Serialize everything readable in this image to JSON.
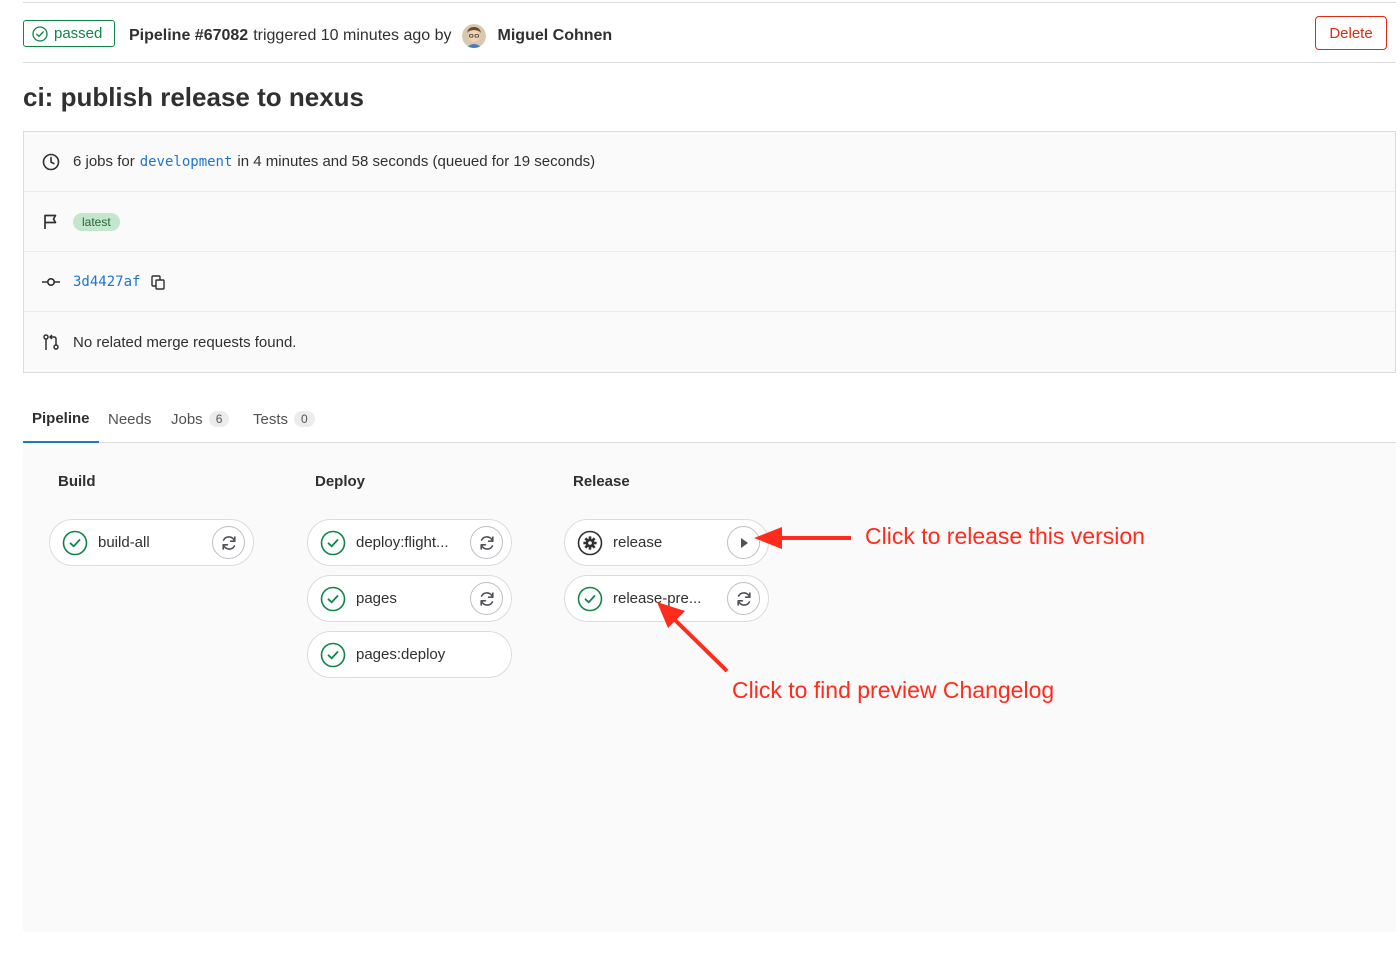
{
  "header": {
    "status": "passed",
    "pipeline_id": "Pipeline #67082",
    "triggered_text": "triggered 10 minutes ago by",
    "author": "Miguel Cohnen",
    "delete_label": "Delete"
  },
  "title": "ci: publish release to nexus",
  "info": {
    "jobs_prefix": "6 jobs for",
    "branch": "development",
    "jobs_suffix": "in 4 minutes and 58 seconds (queued for 19 seconds)",
    "tag": "latest",
    "commit": "3d4427af",
    "merge_requests": "No related merge requests found."
  },
  "tabs": [
    {
      "label": "Pipeline",
      "count": null,
      "active": true
    },
    {
      "label": "Needs",
      "count": null,
      "active": false
    },
    {
      "label": "Jobs",
      "count": "6",
      "active": false
    },
    {
      "label": "Tests",
      "count": "0",
      "active": false
    }
  ],
  "stages": [
    {
      "name": "Build",
      "jobs": [
        {
          "name": "build-all",
          "status": "success",
          "action": "retry-icon"
        }
      ]
    },
    {
      "name": "Deploy",
      "jobs": [
        {
          "name": "deploy:flight...",
          "status": "success",
          "action": "retry-icon"
        },
        {
          "name": "pages",
          "status": "success",
          "action": "retry-icon"
        },
        {
          "name": "pages:deploy",
          "status": "success",
          "action": null
        }
      ]
    },
    {
      "name": "Release",
      "jobs": [
        {
          "name": "release",
          "status": "manual",
          "action": "play-icon"
        },
        {
          "name": "release-pre...",
          "status": "success",
          "action": "retry-icon"
        }
      ]
    }
  ],
  "annotations": {
    "release_note": "Click to release this version",
    "preview_note": "Click to find preview Changelog"
  },
  "colors": {
    "success": "#108548",
    "danger": "#dd2b0e",
    "link": "#1f75cb",
    "annotation": "#ff2b1c"
  }
}
